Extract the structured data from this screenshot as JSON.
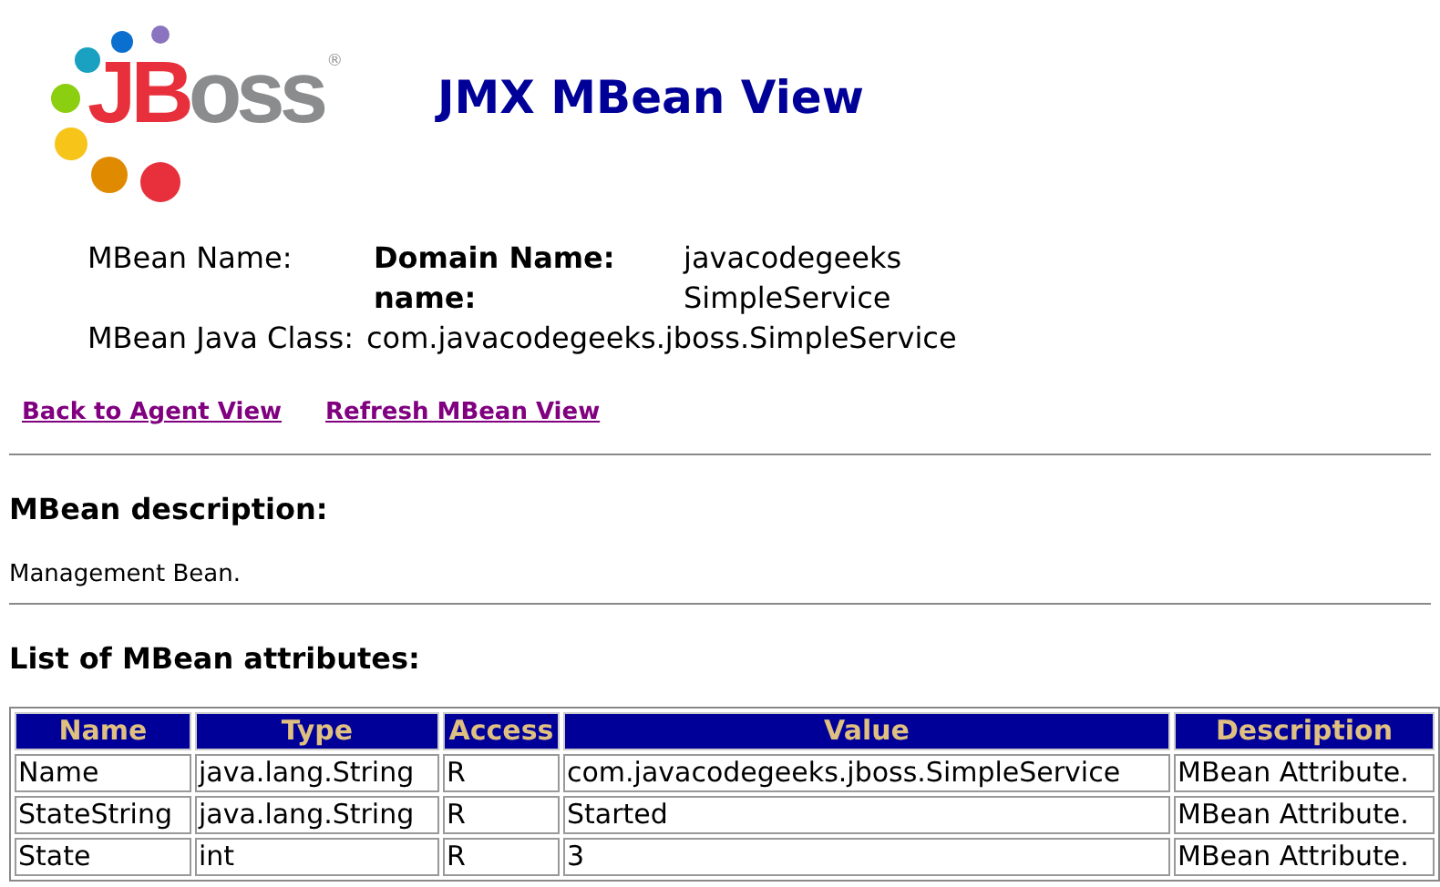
{
  "logo": {
    "red_text": "JB",
    "grey_text": "oss",
    "mark": "®"
  },
  "title": "JMX MBean View",
  "info": [
    {
      "label": "MBean Name:",
      "key": "Domain Name:",
      "value": "javacodegeeks"
    },
    {
      "key": "name:",
      "value": "SimpleService"
    },
    {
      "label": "MBean Java Class:",
      "value": "com.javacodegeeks.jboss.SimpleService"
    }
  ],
  "links": [
    "Back to Agent View",
    "Refresh MBean View"
  ],
  "description_heading": "MBean description:",
  "description": "Management Bean.",
  "attributes_heading": "List of MBean attributes:",
  "table": {
    "columns": [
      "Name",
      "Type",
      "Access",
      "Value",
      "Description"
    ],
    "rows": [
      [
        "Name",
        "java.lang.String",
        "R",
        "com.javacodegeeks.jboss.SimpleService",
        "MBean Attribute."
      ],
      [
        "StateString",
        "java.lang.String",
        "R",
        "Started",
        "MBean Attribute."
      ],
      [
        "State",
        "int",
        "R",
        "3",
        "MBean Attribute."
      ]
    ]
  }
}
